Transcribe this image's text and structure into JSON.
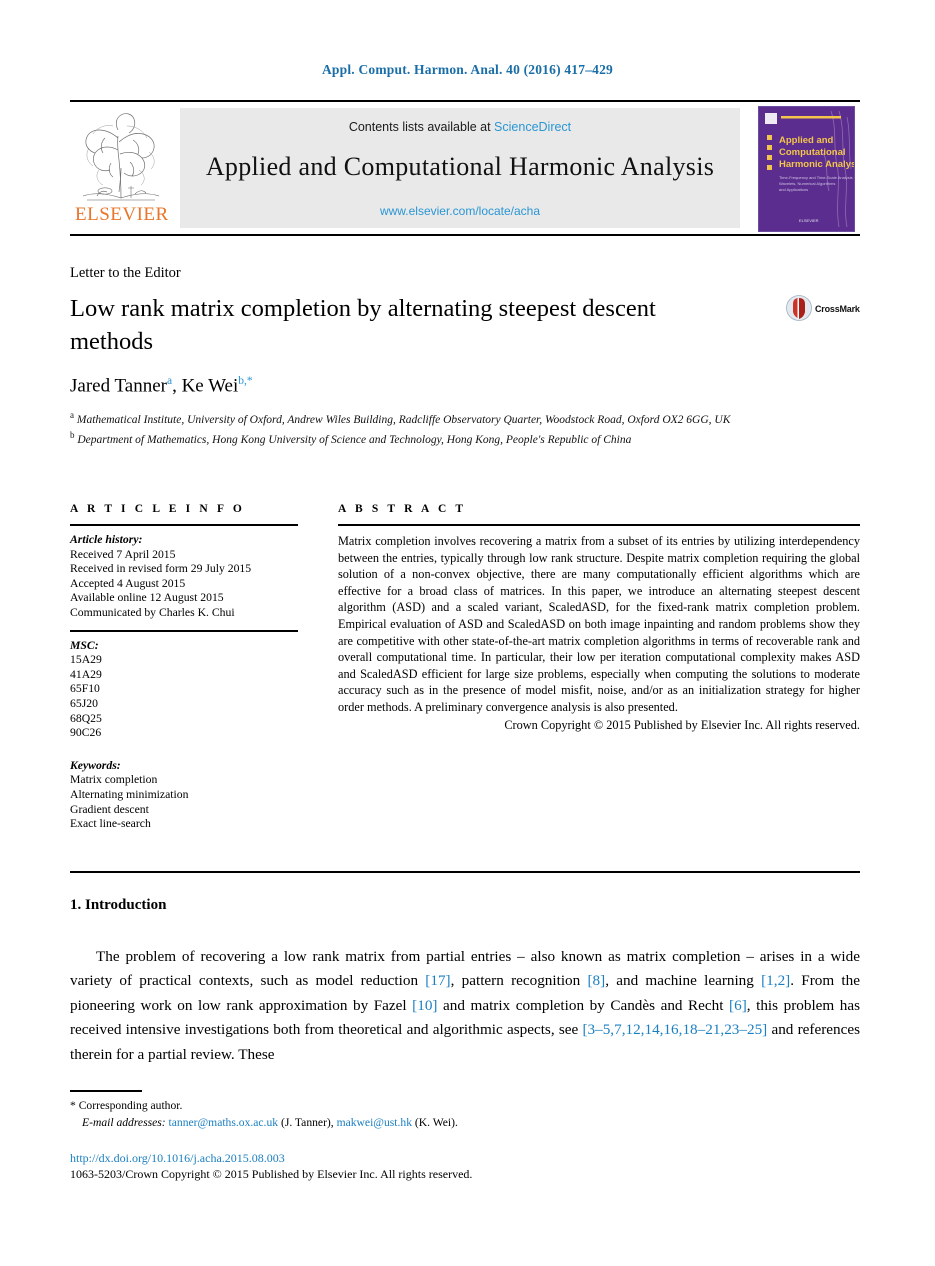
{
  "running_head": "Appl. Comput. Harmon. Anal. 40 (2016) 417–429",
  "masthead": {
    "publisher_name": "ELSEVIER",
    "contents_prefix": "Contents lists available at ",
    "contents_link": "ScienceDirect",
    "journal_title": "Applied and Computational Harmonic Analysis",
    "journal_url": "www.elsevier.com/locate/acha",
    "cover": {
      "line1": "Applied and",
      "line2": "Computational",
      "line3": "Harmonic Analysis",
      "bg_color": "#5b2d8e",
      "text_color": "#f3c54b"
    }
  },
  "article": {
    "doctype": "Letter to the Editor",
    "title": "Low rank matrix completion by alternating steepest descent methods",
    "crossmark_label": "CrossMark",
    "authors": "Jared Tanner",
    "author1_marker": "a",
    "author2": "Ke Wei",
    "author2_marker": "b,*",
    "affiliation_a_marker": "a",
    "affiliation_a": "Mathematical Institute, University of Oxford, Andrew Wiles Building, Radcliffe Observatory Quarter, Woodstock Road, Oxford OX2 6GG, UK",
    "affiliation_b_marker": "b",
    "affiliation_b": "Department of Mathematics, Hong Kong University of Science and Technology, Hong Kong, People's Republic of China"
  },
  "info": {
    "heading": "A R T I C L E     I N F O",
    "history_label": "Article history:",
    "history": [
      "Received 7 April 2015",
      "Received in revised form 29 July 2015",
      "Accepted 4 August 2015",
      "Available online 12 August 2015",
      "Communicated by Charles K. Chui"
    ],
    "msc_label": "MSC:",
    "msc": [
      "15A29",
      "41A29",
      "65F10",
      "65J20",
      "68Q25",
      "90C26"
    ],
    "keywords_label": "Keywords:",
    "keywords": [
      "Matrix completion",
      "Alternating minimization",
      "Gradient descent",
      "Exact line-search"
    ]
  },
  "abstract": {
    "heading": "A B S T R A C T",
    "text": "Matrix completion involves recovering a matrix from a subset of its entries by utilizing interdependency between the entries, typically through low rank structure. Despite matrix completion requiring the global solution of a non-convex objective, there are many computationally efficient algorithms which are effective for a broad class of matrices. In this paper, we introduce an alternating steepest descent algorithm (ASD) and a scaled variant, ScaledASD, for the fixed-rank matrix completion problem. Empirical evaluation of ASD and ScaledASD on both image inpainting and random problems show they are competitive with other state-of-the-art matrix completion algorithms in terms of recoverable rank and overall computational time. In particular, their low per iteration computational complexity makes ASD and ScaledASD efficient for large size problems, especially when computing the solutions to moderate accuracy such as in the presence of model misfit, noise, and/or as an initialization strategy for higher order methods. A preliminary convergence analysis is also presented.",
    "copyright": "Crown Copyright © 2015 Published by Elsevier Inc. All rights reserved."
  },
  "body": {
    "section_heading": "1. Introduction",
    "p1_a": "The problem of recovering a low rank matrix from partial entries – also known as matrix completion – arises in a wide variety of practical contexts, such as model reduction ",
    "p1_c1": "[17]",
    "p1_b": ", pattern recognition ",
    "p1_c2": "[8]",
    "p1_c": ", and machine learning ",
    "p1_c3": "[1,2]",
    "p1_d": ". From the pioneering work on low rank approximation by Fazel ",
    "p1_c4": "[10]",
    "p1_e": " and matrix completion by Candès and Recht ",
    "p1_c5": "[6]",
    "p1_f": ", this problem has received intensive investigations both from theoretical and algorithmic aspects, see ",
    "p1_c6": "[3–5,7,12,14,16,18–21,23–25]",
    "p1_g": " and references therein for a partial review. These"
  },
  "footer": {
    "corresponding_marker": "*",
    "corresponding": "Corresponding author.",
    "email_label": "E-mail addresses:",
    "email1": "tanner@maths.ox.ac.uk",
    "email1_owner": "(J. Tanner)",
    "email2": "makwei@ust.hk",
    "email2_owner": "(K. Wei)",
    "doi": "http://dx.doi.org/10.1016/j.acha.2015.08.003",
    "issn_line": "1063-5203/Crown Copyright © 2015 Published by Elsevier Inc. All rights reserved."
  },
  "colors": {
    "link": "#1a7fc1",
    "sciencedirect": "#2a96d4",
    "elsevier_orange": "#e8752a",
    "cover_purple": "#5b2d8e"
  }
}
